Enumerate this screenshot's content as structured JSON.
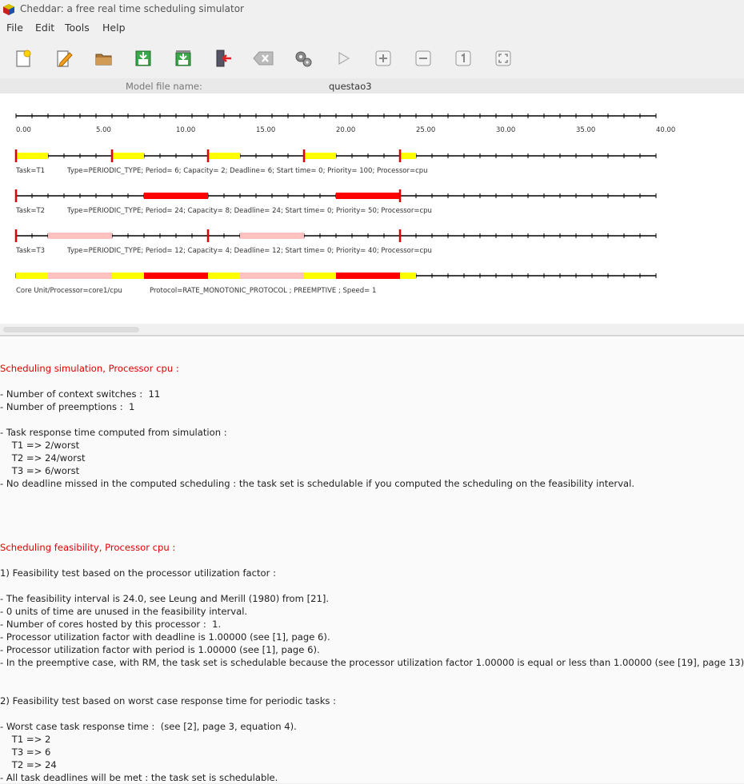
{
  "window": {
    "title": "Cheddar: a free real time scheduling simulator"
  },
  "menu": {
    "file": "File",
    "edit": "Edit",
    "tools": "Tools",
    "help": "Help"
  },
  "toolbar": {
    "icons": [
      "new-file-icon",
      "edit-icon",
      "open-folder-icon",
      "save-icon",
      "save-as-icon",
      "exit-icon",
      "delete-icon",
      "settings-gears-icon",
      "run-icon",
      "zoom-in-icon",
      "zoom-out-icon",
      "zoom-reset-icon",
      "fit-view-icon"
    ]
  },
  "model": {
    "label": "Model file name:",
    "value": "questao3"
  },
  "gantt": {
    "axis_labels": [
      "0.00",
      "5.00",
      "10.00",
      "15.00",
      "20.00",
      "25.00",
      "30.00",
      "35.00",
      "40.00"
    ],
    "tasks": [
      {
        "name": "Task=T1",
        "info": "Type=PERIODIC_TYPE; Period= 6; Capacity= 2; Deadline= 6; Start time= 0; Priority= 100; Processor=cpu"
      },
      {
        "name": "Task=T2",
        "info": "Type=PERIODIC_TYPE; Period= 24; Capacity= 8; Deadline= 24; Start time= 0; Priority= 50; Processor=cpu"
      },
      {
        "name": "Task=T3",
        "info": "Type=PERIODIC_TYPE; Period= 12; Capacity= 4; Deadline= 12; Start time= 0; Priority= 40; Processor=cpu"
      }
    ],
    "processor": {
      "name": "Core Unit/Processor=core1/cpu",
      "info": "Protocol=RATE_MONOTONIC_PROTOCOL ; PREEMPTIVE ; Speed= 1"
    },
    "colors": {
      "T1": "#ffff00",
      "T2": "#ff0000",
      "T3": "#ffc0c0",
      "marker": "#e00000"
    },
    "schedule": {
      "T1": [
        [
          0,
          2
        ],
        [
          6,
          8
        ],
        [
          12,
          14
        ],
        [
          18,
          20
        ],
        [
          24,
          25
        ]
      ],
      "T2": [
        [
          8,
          12
        ],
        [
          20,
          24
        ]
      ],
      "T3": [
        [
          2,
          6
        ],
        [
          14,
          18
        ]
      ],
      "releases": {
        "T1": [
          0,
          6,
          12,
          18,
          24
        ],
        "T2": [
          0,
          24
        ],
        "T3": [
          0,
          12,
          24
        ]
      }
    }
  },
  "results": {
    "lines": [
      {
        "text": "Scheduling simulation, Processor cpu :",
        "red": true
      },
      {
        "text": ""
      },
      {
        "text": "- Number of context switches :  11"
      },
      {
        "text": "- Number of preemptions :  1"
      },
      {
        "text": ""
      },
      {
        "text": "- Task response time computed from simulation :"
      },
      {
        "text": "    T1 => 2/worst"
      },
      {
        "text": "    T2 => 24/worst"
      },
      {
        "text": "    T3 => 6/worst"
      },
      {
        "text": "- No deadline missed in the computed scheduling : the task set is schedulable if you computed the scheduling on the feasibility interval."
      },
      {
        "text": ""
      },
      {
        "text": ""
      },
      {
        "text": ""
      },
      {
        "text": ""
      },
      {
        "text": "Scheduling feasibility, Processor cpu :",
        "red": true
      },
      {
        "text": ""
      },
      {
        "text": "1) Feasibility test based on the processor utilization factor :"
      },
      {
        "text": ""
      },
      {
        "text": "- The feasibility interval is 24.0, see Leung and Merill (1980) from [21]."
      },
      {
        "text": "- 0 units of time are unused in the feasibility interval."
      },
      {
        "text": "- Number of cores hosted by this processor :  1."
      },
      {
        "text": "- Processor utilization factor with deadline is 1.00000 (see [1], page 6)."
      },
      {
        "text": "- Processor utilization factor with period is 1.00000 (see [1], page 6)."
      },
      {
        "text": "- In the preemptive case, with RM, the task set is schedulable because the processor utilization factor 1.00000 is equal or less than 1.00000 (see [19], page 13)."
      },
      {
        "text": ""
      },
      {
        "text": ""
      },
      {
        "text": "2) Feasibility test based on worst case response time for periodic tasks :"
      },
      {
        "text": ""
      },
      {
        "text": "- Worst case task response time :  (see [2], page 3, equation 4)."
      },
      {
        "text": "    T1 => 2"
      },
      {
        "text": "    T3 => 6"
      },
      {
        "text": "    T2 => 24"
      },
      {
        "text": "- All task deadlines will be met : the task set is schedulable."
      }
    ]
  }
}
